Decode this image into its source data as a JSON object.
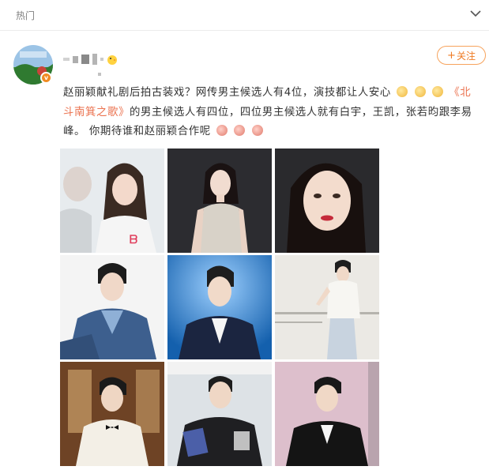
{
  "header": {
    "title": "热门"
  },
  "post": {
    "author": {
      "name_visible": "",
      "verified": true
    },
    "follow_label": "关注",
    "text": {
      "part1": "赵丽颖献礼剧后拍古装戏？网传男主候选人有4位，演技都让人安心",
      "link": "《北斗南箕之歌》",
      "part2": "的男主候选人有四位，四位男主候选人就有白宇，王凯，张若昀跟李易峰。 你期待谁和赵丽颖合作呢"
    },
    "emojis": [
      "doge-icon",
      "doge-icon",
      "doge-icon",
      "pig-icon",
      "pig-icon",
      "pig-icon"
    ],
    "photos": [
      {
        "name": "photo-1",
        "bg": "#e9ecef",
        "subject": "woman-white-hoodie"
      },
      {
        "name": "photo-2",
        "bg": "#2f2f33",
        "subject": "woman-sleeveless-dress"
      },
      {
        "name": "photo-3",
        "bg": "#2b2b2e",
        "subject": "woman-closeup-red-lips"
      },
      {
        "name": "photo-4",
        "bg": "#f2f2f2",
        "subject": "man-denim-jacket"
      },
      {
        "name": "photo-5",
        "bg": "#1a6fb8",
        "subject": "man-navy-suit-stage"
      },
      {
        "name": "photo-6",
        "bg": "#e9e7e2",
        "subject": "man-white-jacket-standing"
      },
      {
        "name": "photo-7",
        "bg": "#7a4d2c",
        "subject": "man-white-tuxedo"
      },
      {
        "name": "photo-8",
        "bg": "#d8dde2",
        "subject": "man-black-sweater"
      },
      {
        "name": "photo-9",
        "bg": "#dfc2cf",
        "subject": "man-black-suit-pink-bg"
      }
    ]
  },
  "colors": {
    "accent": "#ef7a22",
    "text": "#333333",
    "muted": "#808080",
    "link": "#eb7350"
  }
}
